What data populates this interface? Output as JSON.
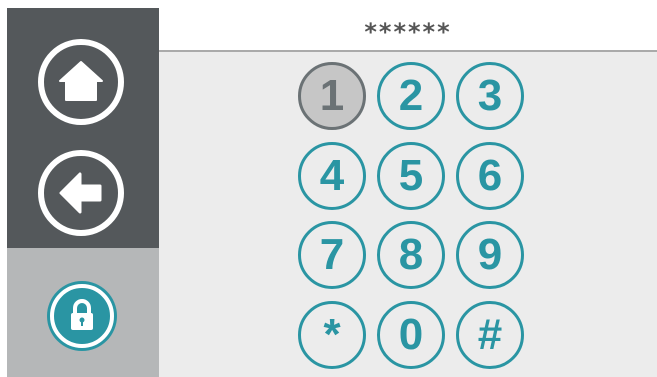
{
  "screen": "keypad",
  "display": {
    "value": "******"
  },
  "sidebar": {
    "items": [
      {
        "name": "home",
        "icon": "home-icon",
        "active": false
      },
      {
        "name": "back",
        "icon": "back-arrow-icon",
        "active": false
      },
      {
        "name": "security",
        "icon": "lock-icon",
        "active": true
      }
    ]
  },
  "keypad": {
    "keys": [
      "1",
      "2",
      "3",
      "4",
      "5",
      "6",
      "7",
      "8",
      "9",
      "*",
      "0",
      "#"
    ],
    "pressed_key": "1"
  },
  "colors": {
    "accent": "#2a95a3",
    "sidebar_dark": "#54585b",
    "sidebar_active": "#b5b7b8",
    "background": "#ececec",
    "pressed": "#c6c6c6"
  }
}
